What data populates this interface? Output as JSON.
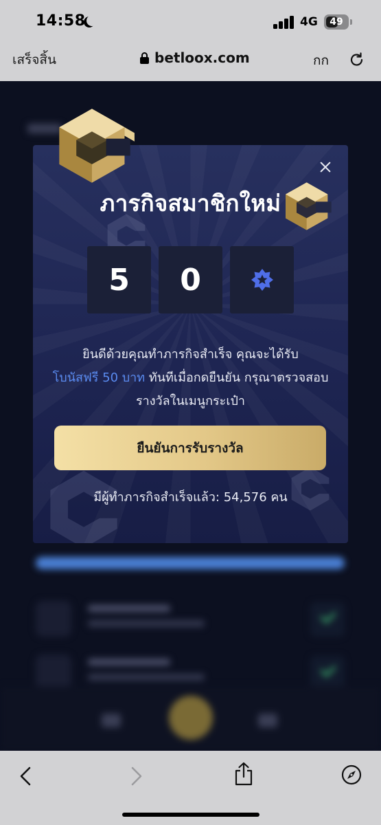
{
  "status_bar": {
    "time": "14:58",
    "network": "4G",
    "battery": "49"
  },
  "browser": {
    "done_label": "เสร็จสิ้น",
    "url": "betloox.com",
    "text_size_label": "กก"
  },
  "modal": {
    "title": "ภารกิจสมาชิกใหม่",
    "code_digits": [
      "5",
      "0"
    ],
    "message_part1": "ยินดีด้วยคุณทำภารกิจสำเร็จ คุณจะได้รับ",
    "message_highlight": "โบนัสฟรี 50 บาท",
    "message_part2": "ทันทีเมื่อกดยืนยัน กรุณาตรวจสอบรางวัลในเมนูกระเป๋า",
    "confirm_label": "ยืนยันการรับรางวัล",
    "completed_label": "มีผู้ทำภารกิจสำเร็จแล้ว: 54,576 คน"
  },
  "colors": {
    "modal_bg": "#1e2552",
    "highlight": "#5a8bf0",
    "button_gold": "#e3c888",
    "star_blue": "#4f6ee8"
  },
  "icons": [
    "moon-icon",
    "signal-icon",
    "battery-icon",
    "lock-icon",
    "reload-icon",
    "close-icon",
    "star-badge-icon",
    "back-icon",
    "forward-icon",
    "share-icon",
    "compass-icon",
    "brand-logo-icon"
  ]
}
